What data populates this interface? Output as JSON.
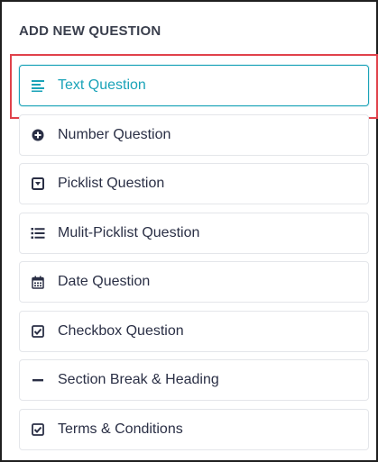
{
  "panel": {
    "heading": "ADD NEW QUESTION"
  },
  "colors": {
    "accent": "#1aa3b8",
    "highlight": "#e0424b",
    "text": "#2a2f45",
    "icon": "#2a2f45"
  },
  "items": [
    {
      "label": "Text Question",
      "icon": "text-lines-icon",
      "active": true
    },
    {
      "label": "Number Question",
      "icon": "plus-circle-icon",
      "active": false
    },
    {
      "label": "Picklist Question",
      "icon": "dropdown-box-icon",
      "active": false
    },
    {
      "label": "Mulit-Picklist Question",
      "icon": "bullet-list-icon",
      "active": false
    },
    {
      "label": "Date Question",
      "icon": "calendar-icon",
      "active": false
    },
    {
      "label": "Checkbox Question",
      "icon": "checkbox-icon",
      "active": false
    },
    {
      "label": "Section Break & Heading",
      "icon": "minus-icon",
      "active": false
    },
    {
      "label": "Terms & Conditions",
      "icon": "checkbox-icon",
      "active": false
    }
  ]
}
